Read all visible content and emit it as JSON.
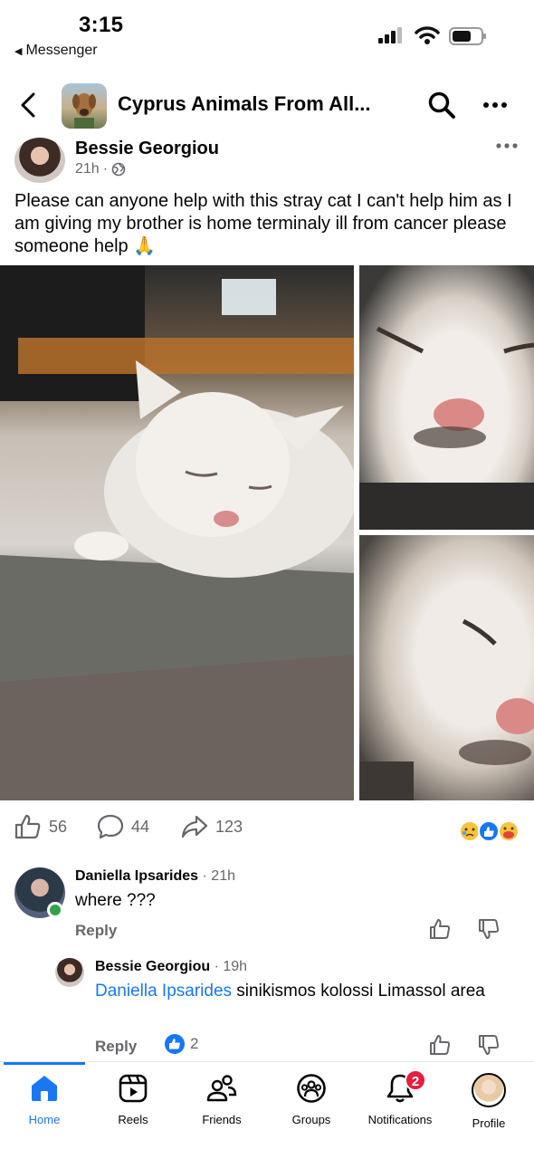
{
  "status_bar": {
    "time": "3:15",
    "back_app_label": "Messenger"
  },
  "header": {
    "title": "Cyprus Animals From All...",
    "back_icon": "chevron-left-icon",
    "search_icon": "search-icon",
    "more_icon": "more-horizontal-icon"
  },
  "post": {
    "author": "Bessie Georgiou",
    "time": "21h",
    "privacy_icon": "globe-icon",
    "text": "Please can anyone help with this stray cat I can't help him as I am giving my brother is home terminaly ill from cancer please someone help 🙏",
    "likes": "56",
    "comments": "44",
    "shares": "123"
  },
  "comments": [
    {
      "author": "Daniella Ipsarides",
      "time": "· 21h",
      "text": "where ???",
      "reply_label": "Reply"
    },
    {
      "author": "Bessie Georgiou",
      "time": "· 19h",
      "mention": "Daniella Ipsarides",
      "text": " sinikismos kolossi Limassol area",
      "reply_label": "Reply",
      "like_count": "2"
    }
  ],
  "tabs": [
    {
      "label": "Home",
      "icon": "home-icon",
      "active": true
    },
    {
      "label": "Reels",
      "icon": "reels-icon"
    },
    {
      "label": "Friends",
      "icon": "friends-icon"
    },
    {
      "label": "Groups",
      "icon": "groups-icon"
    },
    {
      "label": "Notifications",
      "icon": "bell-icon",
      "badge": "2"
    },
    {
      "label": "Profile",
      "icon": "profile-avatar"
    }
  ],
  "colors": {
    "accent": "#1877f2",
    "badge": "#e41e3f",
    "secondary_text": "#65676b"
  }
}
